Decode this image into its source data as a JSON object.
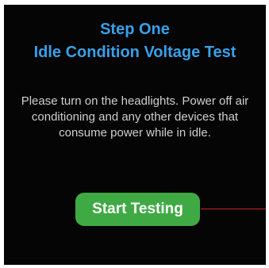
{
  "header": {
    "step_title": "Step One",
    "test_title": "Idle Condition Voltage Test"
  },
  "instructions": {
    "text": "Please turn on the headlights.  Power off air conditioning and any other devices that consume power while in idle."
  },
  "actions": {
    "start_label": "Start Testing"
  },
  "colors": {
    "title": "#3aa0e8",
    "button": "#3faa44",
    "background": "#050505",
    "connector": "#c8201f"
  }
}
